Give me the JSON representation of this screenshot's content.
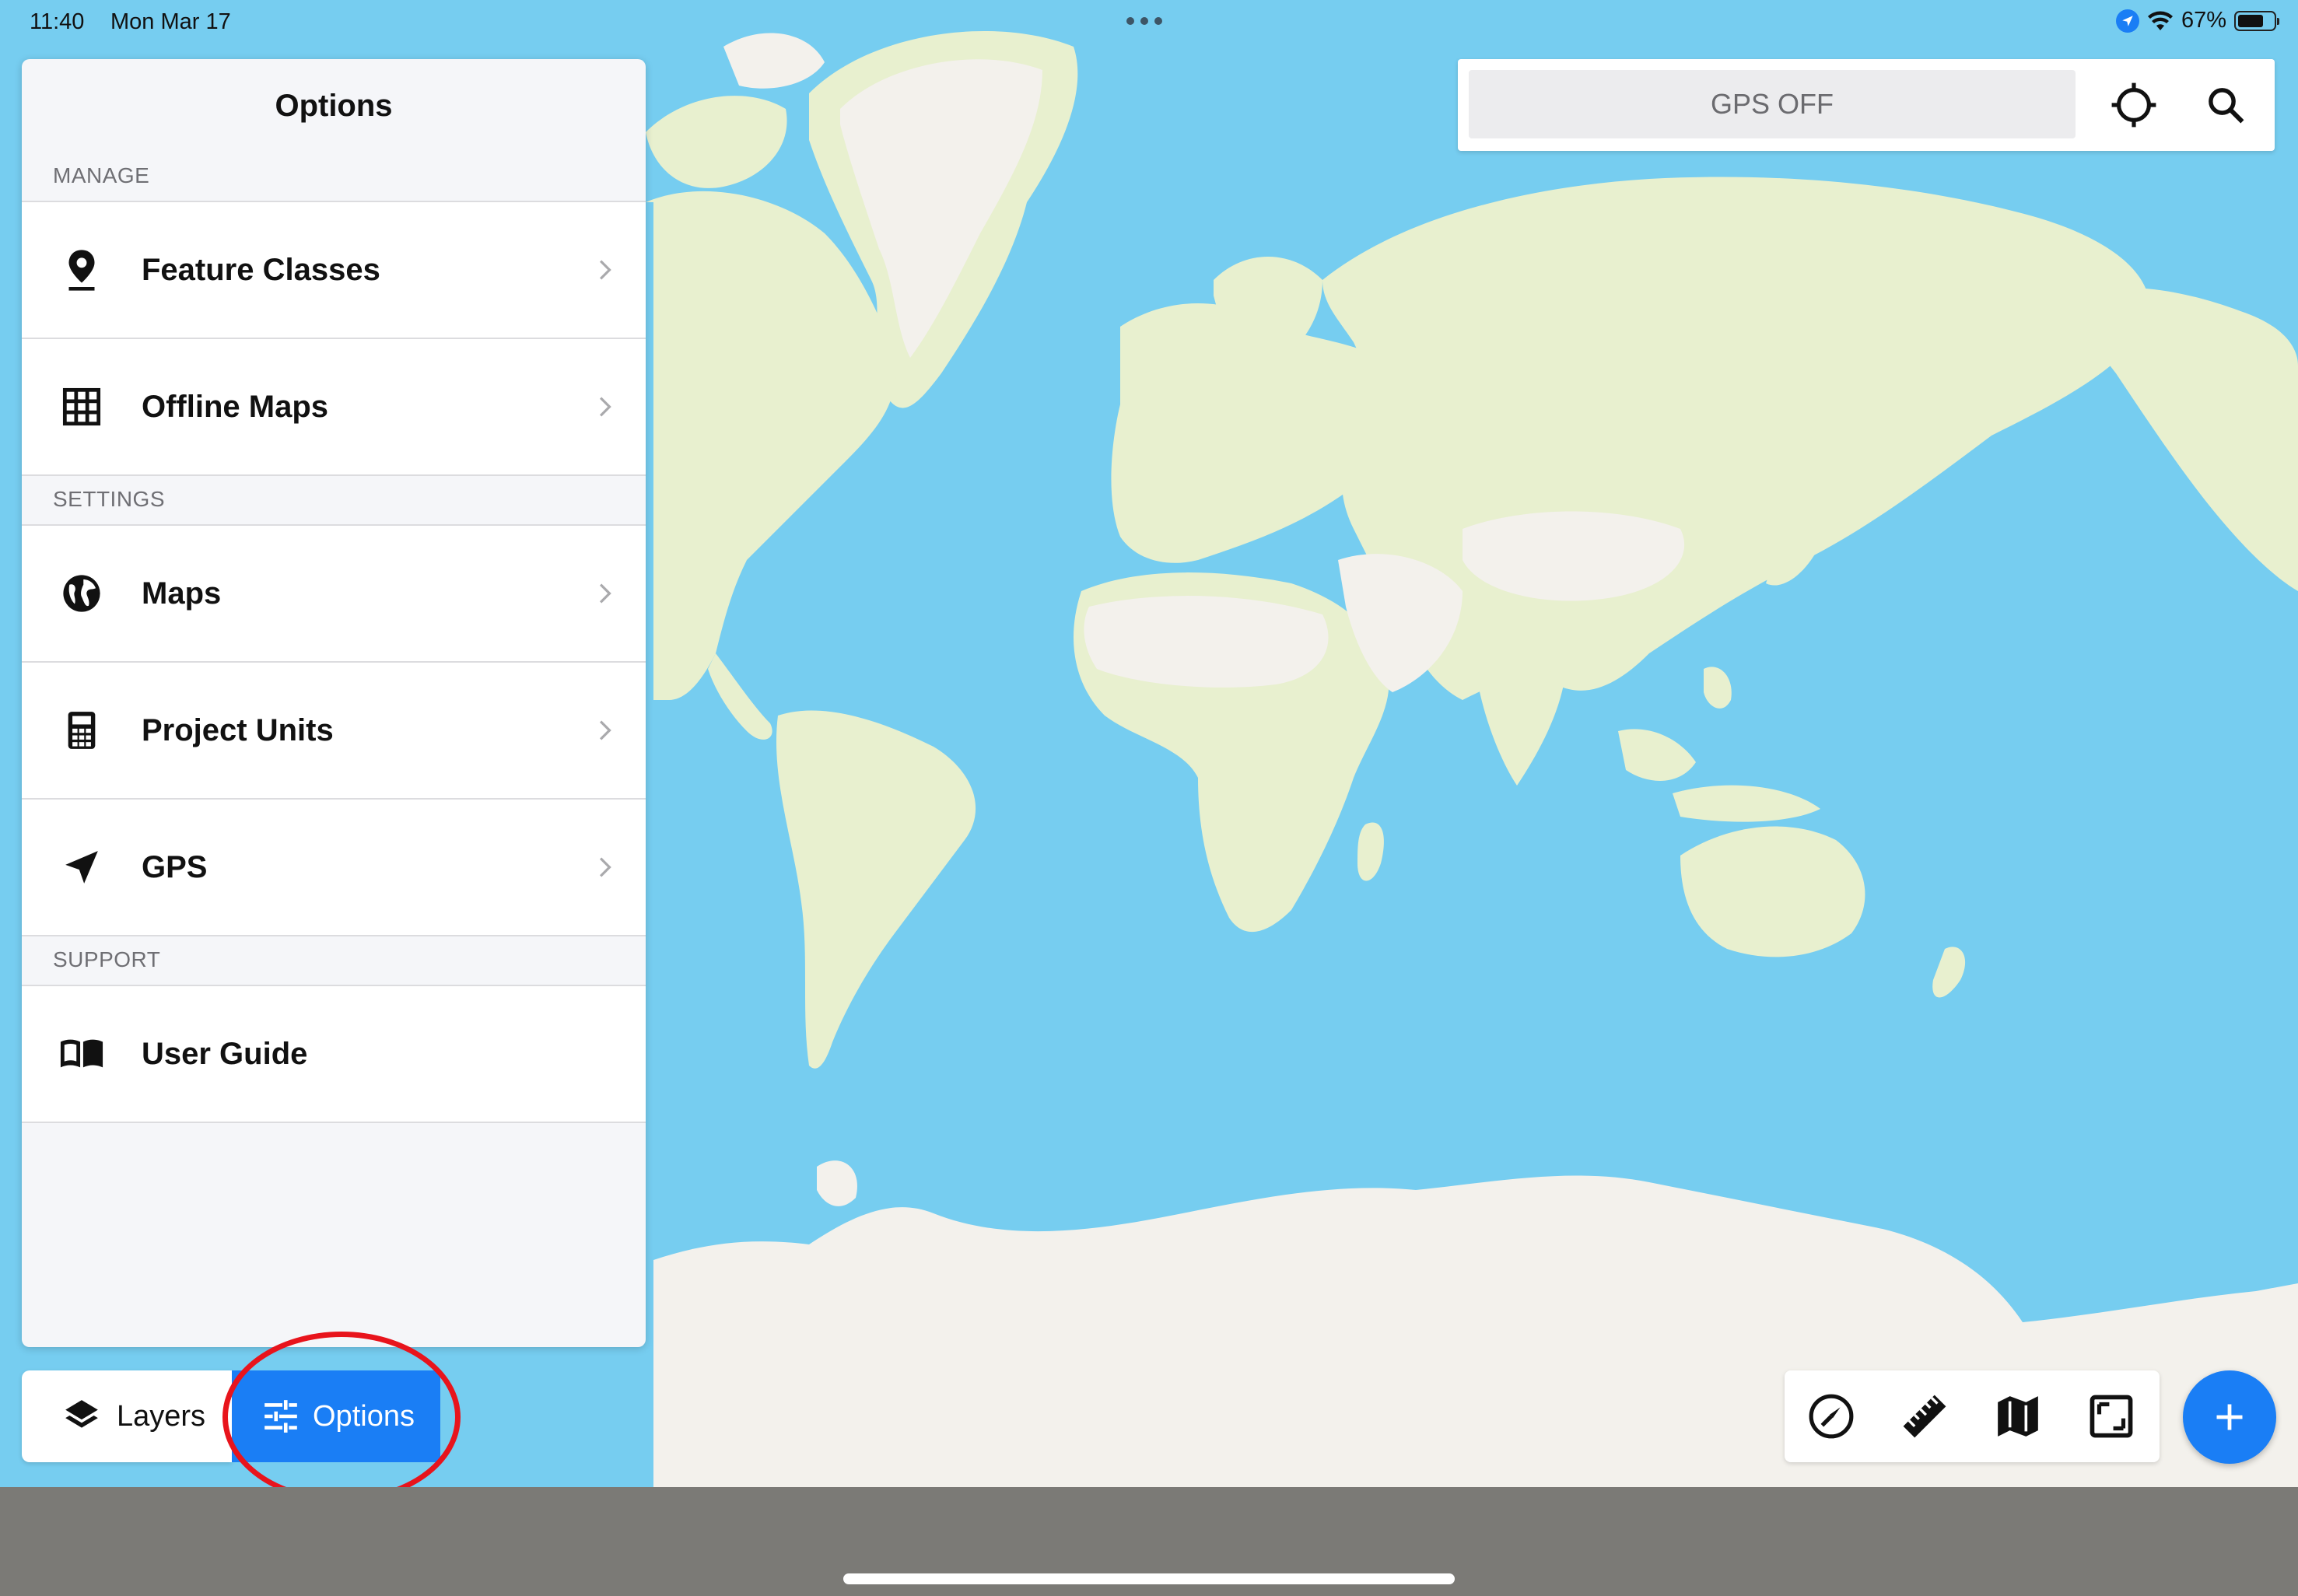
{
  "status_bar": {
    "time": "11:40",
    "date": "Mon Mar 17",
    "battery": "67%"
  },
  "panel": {
    "title": "Options",
    "sections": [
      {
        "header": "MANAGE",
        "items": [
          {
            "label": "Feature Classes",
            "icon": "map-pin-icon"
          },
          {
            "label": "Offline Maps",
            "icon": "grid-icon"
          }
        ]
      },
      {
        "header": "SETTINGS",
        "items": [
          {
            "label": "Maps",
            "icon": "globe-icon"
          },
          {
            "label": "Project Units",
            "icon": "calculator-icon"
          },
          {
            "label": "GPS",
            "icon": "navigation-arrow-icon"
          }
        ]
      },
      {
        "header": "SUPPORT",
        "items": [
          {
            "label": "User Guide",
            "icon": "book-icon"
          }
        ]
      }
    ]
  },
  "tabs": {
    "layers_label": "Layers",
    "options_label": "Options",
    "active": "Options"
  },
  "search_bar": {
    "gps_status": "GPS OFF"
  },
  "toolbar": {
    "tools": [
      "compass-icon",
      "ruler-icon",
      "map-icon",
      "frame-icon"
    ]
  },
  "colors": {
    "accent": "#1a7ef5",
    "ocean": "#76cdf0",
    "land": "#e8f0cf",
    "ice": "#f3f1ec",
    "highlight": "#e8141c"
  }
}
